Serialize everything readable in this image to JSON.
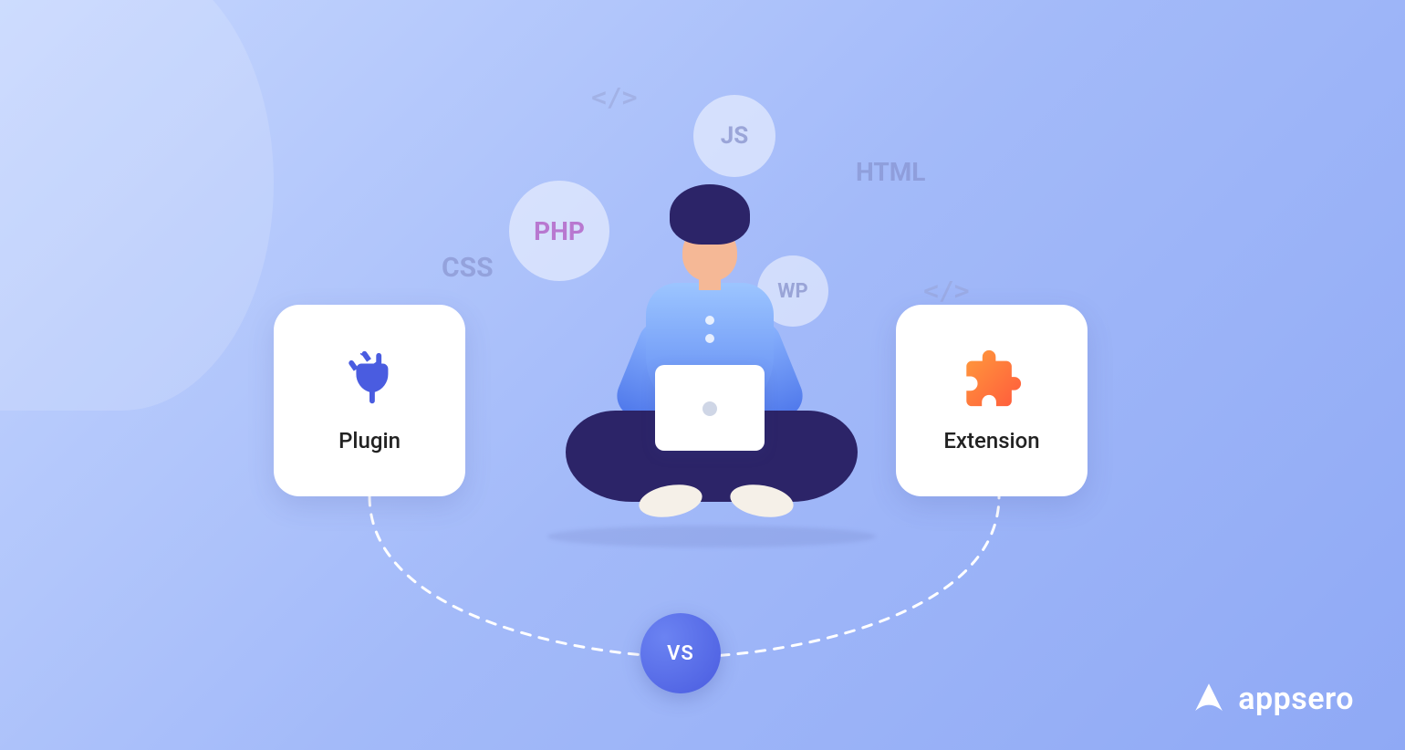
{
  "floating": {
    "code1": "</>",
    "css": "CSS",
    "html": "HTML",
    "code2": "</>"
  },
  "bubbles": {
    "js": "JS",
    "php": "PHP",
    "wp": "WP"
  },
  "cards": {
    "left": "Plugin",
    "right": "Extension"
  },
  "vs_label": "VS",
  "brand": "appsero"
}
